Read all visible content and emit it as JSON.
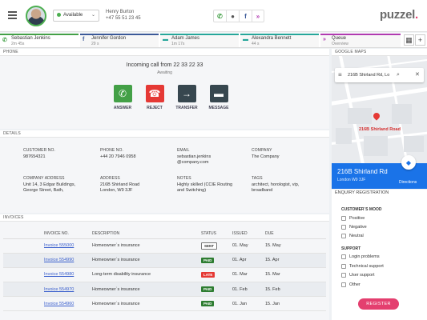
{
  "colors": {
    "accent": "#e43f6f",
    "green": "#4caf50",
    "answer": "#43a047",
    "reject": "#e53935",
    "transfer": "#37474f",
    "message": "#37474f",
    "map_blue": "#1a73e8",
    "paid": "#2e7d32",
    "late": "#e53935"
  },
  "header": {
    "status": "Available",
    "agent_name": "Henry Burton",
    "agent_phone": "+47 55 51 23 45",
    "logo_main": "puzzel",
    "logo_dot": ".",
    "tools": [
      {
        "icon": "phone-icon",
        "glyph": "✆",
        "color": "#43a047"
      },
      {
        "icon": "person-icon",
        "glyph": "●",
        "color": "#555"
      },
      {
        "icon": "facebook-icon",
        "glyph": "f",
        "color": "#3b5998"
      },
      {
        "icon": "forward-icon",
        "glyph": "»",
        "color": "#b03ab0"
      }
    ]
  },
  "tabs": [
    {
      "name": "Sebastian Jenkins",
      "sub": "2m 45s",
      "icon": "phone-icon",
      "glyph": "✆",
      "color": "#43a047"
    },
    {
      "name": "Jennifer Gordon",
      "sub": "29 s",
      "icon": "facebook-icon",
      "glyph": "f",
      "color": "#3b5998"
    },
    {
      "name": "Adam James",
      "sub": "1m 17s",
      "icon": "chat-icon",
      "glyph": "▬",
      "color": "#26a69a"
    },
    {
      "name": "Alexandra Bennett",
      "sub": "44 s",
      "icon": "chat-icon",
      "glyph": "▬",
      "color": "#26a69a"
    },
    {
      "name": "Queue",
      "sub": "Overview",
      "icon": "forward-icon",
      "glyph": "»",
      "color": "#b03ab0"
    }
  ],
  "phone": {
    "header": "PHONE",
    "incoming": "Incoming call from 22 33 22 33",
    "awaiting": "Awaiting",
    "actions": [
      {
        "label": "ANSWER",
        "icon": "phone-icon",
        "glyph": "✆"
      },
      {
        "label": "REJECT",
        "icon": "hangup-icon",
        "glyph": "☎"
      },
      {
        "label": "TRANSFER",
        "icon": "transfer-icon",
        "glyph": "→"
      },
      {
        "label": "MESSAGE",
        "icon": "message-icon",
        "glyph": "▬"
      }
    ]
  },
  "details": {
    "header": "DETAILS",
    "customer_no_label": "CUSTOMER NO.",
    "customer_no": "987654321",
    "phone_no_label": "PHONE NO.",
    "phone_no": "+44 20 7946 0958",
    "email_label": "EMAIL",
    "email_1": "sebastian.jenkins",
    "email_2": "@company.com",
    "company_label": "COMPANY",
    "company": "The Company",
    "company_address_label": "COMPANY ADDRESS",
    "company_address_1": "Unit 14, 3 Edgar Buildings,",
    "company_address_2": "George Street, Bath,",
    "address_label": "ADDRESS",
    "address_1": "216B Shirland Road",
    "address_2": "London, W9 3JF",
    "notes_label": "NOTES",
    "notes_1": "Highly skilled (CCIE Routing",
    "notes_2": "and Switching)",
    "tags_label": "TAGS",
    "tags_1": "architect, horologist, vip,",
    "tags_2": "broadband"
  },
  "invoices": {
    "header": "INVOICES",
    "columns": [
      "INVOICE NO.",
      "DESCRIPTION",
      "STATUS",
      "ISSUED",
      "DUE"
    ],
    "rows": [
      {
        "no": "Invoice 555000",
        "desc": "Homeowner`s insurance",
        "status": "SENT",
        "status_type": "sent",
        "issued": "01. May",
        "due": "15. May"
      },
      {
        "no": "Invoice 554990",
        "desc": "Homeowner`s insurance",
        "status": "PAID",
        "status_type": "paid",
        "issued": "01. Apr",
        "due": "15. Apr"
      },
      {
        "no": "Invoice 554980",
        "desc": "Long-term disability insurance",
        "status": "LATE",
        "status_type": "late",
        "issued": "01. Mar",
        "due": "15. Mar"
      },
      {
        "no": "Invoice 554970",
        "desc": "Homeowner`s insurance",
        "status": "PAID",
        "status_type": "paid",
        "issued": "01. Feb",
        "due": "15. Feb"
      },
      {
        "no": "Invoice 554960",
        "desc": "Homeowner`s insurance",
        "status": "PAID",
        "status_type": "paid",
        "issued": "01. Jan",
        "due": "15. Jan"
      }
    ]
  },
  "map": {
    "header": "GOOGLE MAPS",
    "search_value": "216B Shirland Rd, Lo",
    "pin_label": "216B Shirland Road",
    "card_title": "216B Shirland Rd",
    "card_sub": "London W9 3JF",
    "directions": "Directions"
  },
  "enquiry": {
    "header": "ENQUIRY REGISTRATION",
    "mood_header": "CUSTOMER`S MOOD",
    "mood_options": [
      "Positive",
      "Negative",
      "Neutral"
    ],
    "support_header": "SUPPORT",
    "support_options": [
      "Login problems",
      "Technical support",
      "User support",
      "Other"
    ],
    "register": "REGISTER"
  }
}
